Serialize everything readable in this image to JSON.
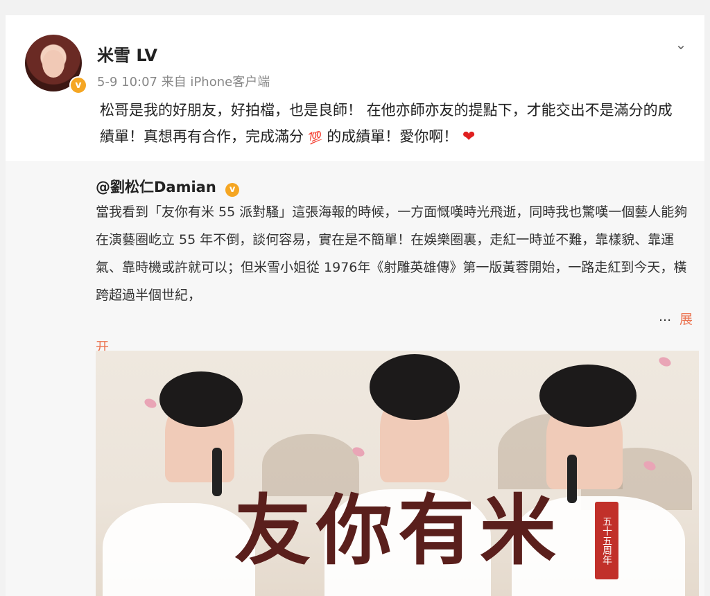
{
  "post": {
    "username": "米雪 LV",
    "verified_badge": "v",
    "meta": "5-9 10:07  来自 iPhone客户端",
    "menu_icon": "chevron-down",
    "text_part1": "松哥是我的好朋友，好拍檔，也是良師！ 在他亦師亦友的提點下，才能交出不是滿分的成績單！真想再有合作，完成滿分",
    "hundred_emoji": "💯",
    "text_part2": "的成績單！愛你啊！",
    "heart": "❤"
  },
  "repost": {
    "author": "@劉松仁Damian",
    "author_badge": "v",
    "text": "當我看到「友你有米 55 派對騷」這張海報的時候，一方面慨嘆時光飛逝，同時我也驚嘆一個藝人能夠在演藝圈屹立 55 年不倒，談何容易，實在是不簡單！在娛樂圈裏，走紅一時並不難，靠樣貌、靠運氣、靠時機或許就可以；但米雪小姐從 1976年《射雕英雄傳》第一版黃蓉開始，一路走紅到今天，橫跨超過半個世紀，",
    "ellipsis": "...",
    "expand_label_1": "展",
    "expand_label_2": "开",
    "poster": {
      "title": "友你有米",
      "seal": "五十五周年"
    }
  },
  "colors": {
    "link": "#eb7350",
    "badge": "#f5a623",
    "seal": "#c1302a"
  }
}
